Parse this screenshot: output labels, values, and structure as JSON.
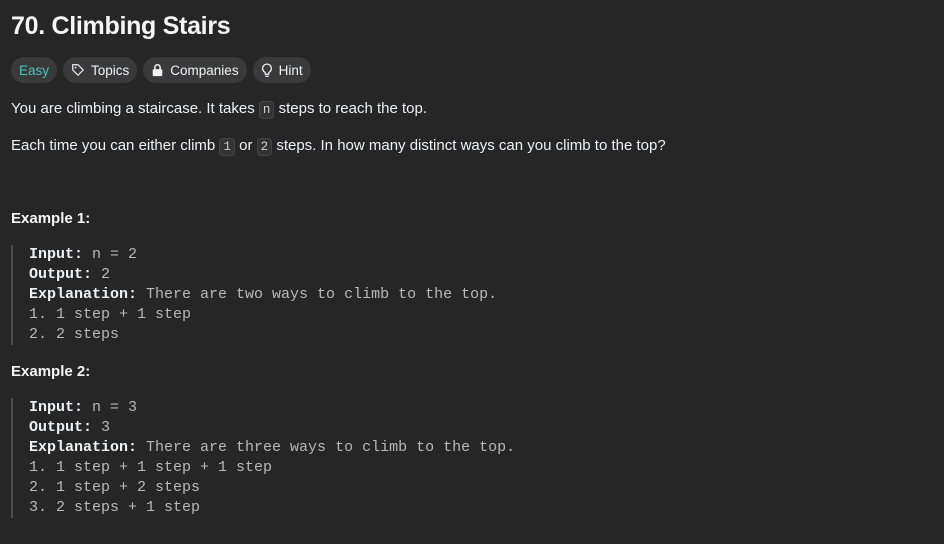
{
  "problem": {
    "title": "70. Climbing Stairs"
  },
  "tags": {
    "difficulty": "Easy",
    "topics": "Topics",
    "companies": "Companies",
    "hint": "Hint"
  },
  "description": {
    "p1_before": "You are climbing a staircase. It takes ",
    "p1_code": "n",
    "p1_after": " steps to reach the top.",
    "p2_before": "Each time you can either climb ",
    "p2_code1": "1",
    "p2_mid": " or ",
    "p2_code2": "2",
    "p2_after": " steps. In how many distinct ways can you climb to the top?"
  },
  "examples": [
    {
      "title": "Example 1:",
      "input_label": "Input:",
      "input_value": " n = 2",
      "output_label": "Output:",
      "output_value": " 2",
      "explanation_label": "Explanation:",
      "explanation_value": " There are two ways to climb to the top.",
      "lines": [
        "1. 1 step + 1 step",
        "2. 2 steps"
      ]
    },
    {
      "title": "Example 2:",
      "input_label": "Input:",
      "input_value": " n = 3",
      "output_label": "Output:",
      "output_value": " 3",
      "explanation_label": "Explanation:",
      "explanation_value": " There are three ways to climb to the top.",
      "lines": [
        "1. 1 step + 1 step + 1 step",
        "2. 1 step + 2 steps",
        "3. 2 steps + 1 step"
      ]
    }
  ],
  "colors": {
    "background": "#262626",
    "easy": "#46c6c2",
    "tag_bg": "#3a3a3a"
  }
}
